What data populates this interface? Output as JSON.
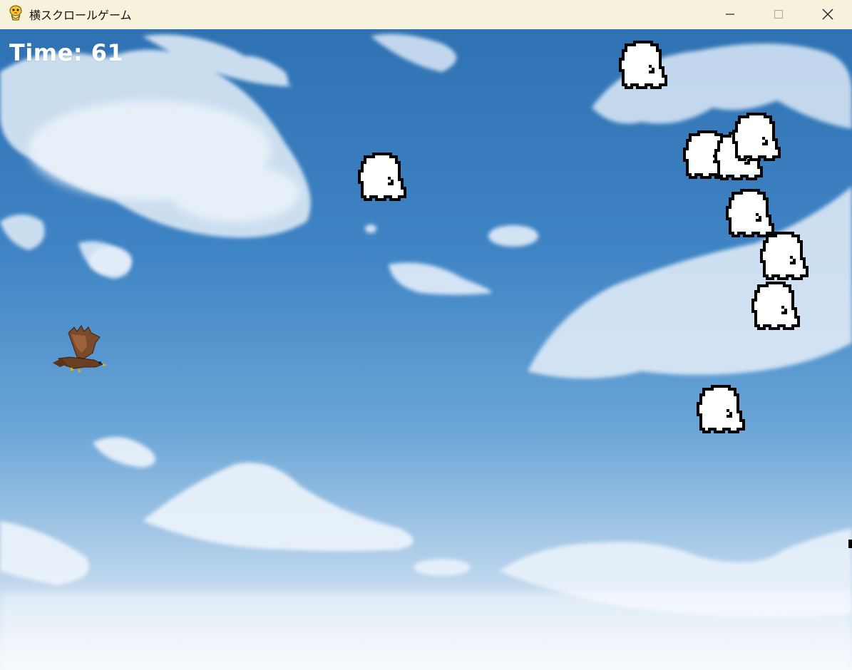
{
  "window": {
    "title": "横スクロールゲーム",
    "app_icon": "python-snake-icon",
    "controls": [
      "minimize-icon",
      "maximize-icon",
      "close-icon"
    ]
  },
  "hud": {
    "time_label": "Time:",
    "time_value": "61"
  },
  "scene": {
    "background": "sky-with-clouds",
    "player": "hawk-sprite",
    "enemy": "ghost-sprite",
    "enemy_count": 10,
    "colors": {
      "sky_top": "#2f73b4",
      "sky_bottom": "#eef4fb",
      "ghost_body": "#ffffff",
      "ghost_outline": "#000000",
      "titlebar": "#f7f2dc"
    }
  }
}
